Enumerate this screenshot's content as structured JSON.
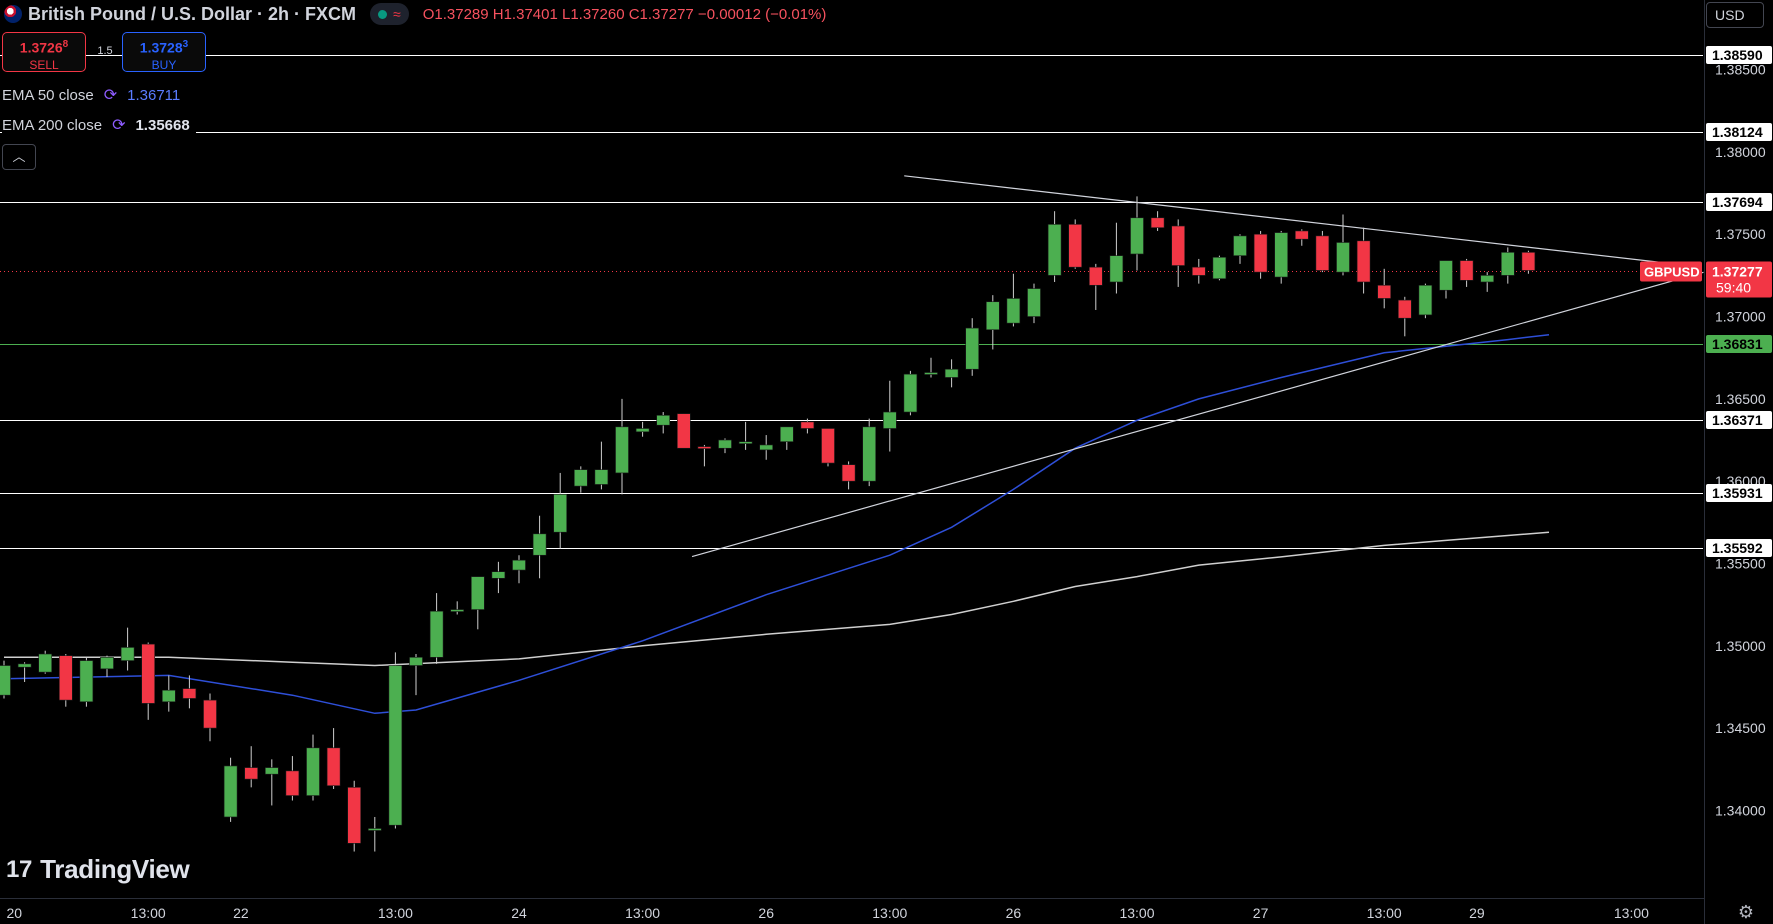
{
  "header": {
    "title": "British Pound / U.S. Dollar · 2h · FXCM",
    "ohlc": "O1.37289 H1.37401 L1.37260 C1.37277 −0.00012 (−0.01%)"
  },
  "trade": {
    "sell_price": "1.3726",
    "sell_price_sup": "8",
    "sell_label": "SELL",
    "buy_price": "1.3728",
    "buy_price_sup": "3",
    "buy_label": "BUY",
    "spread": "1.5"
  },
  "indicators": {
    "ema50_label": "EMA 50 close",
    "ema50_value": "1.36711",
    "ema200_label": "EMA 200 close",
    "ema200_value": "1.35668"
  },
  "currency": "USD",
  "logo_text": "TradingView",
  "collapse_icon": "chevron-up-icon",
  "settings_icon": "gear-icon",
  "colors": {
    "up": "#4caf50",
    "down": "#f23645",
    "ema50": "#2e4fd8",
    "ema200": "#cfcfcf",
    "price_tag": "#f23645",
    "support_tag": "#4caf50"
  },
  "chart_data": {
    "type": "candlestick",
    "symbol": "GBPUSD",
    "interval": "2h",
    "ylim": [
      1.3365,
      1.3868
    ],
    "y_ticks": [
      "1.38500",
      "1.38000",
      "1.37500",
      "1.37000",
      "1.36500",
      "1.36000",
      "1.35500",
      "1.35000",
      "1.34500",
      "1.34000"
    ],
    "x_ticks": [
      {
        "label": "20",
        "index": 0.5
      },
      {
        "label": "13:00",
        "index": 7
      },
      {
        "label": "22",
        "index": 11.5
      },
      {
        "label": "13:00",
        "index": 19
      },
      {
        "label": "24",
        "index": 25
      },
      {
        "label": "13:00",
        "index": 31
      },
      {
        "label": "26",
        "index": 37
      },
      {
        "label": "13:00",
        "index": 43
      },
      {
        "label": "26",
        "index": 49
      },
      {
        "label": "13:00",
        "index": 55
      },
      {
        "label": "27",
        "index": 61
      },
      {
        "label": "13:00",
        "index": 67
      },
      {
        "label": "29",
        "index": 71.5
      },
      {
        "label": "13:00",
        "index": 79
      }
    ],
    "x_slot_count": 82,
    "candles": [
      [
        1.347,
        1.3491,
        1.3468,
        1.3488
      ],
      [
        1.3487,
        1.349,
        1.3478,
        1.3489
      ],
      [
        1.3484,
        1.3497,
        1.3483,
        1.3495
      ],
      [
        1.3494,
        1.3495,
        1.3463,
        1.3467
      ],
      [
        1.3466,
        1.3493,
        1.3463,
        1.3491
      ],
      [
        1.3486,
        1.3494,
        1.3481,
        1.3493
      ],
      [
        1.3491,
        1.3511,
        1.3485,
        1.3499
      ],
      [
        1.3501,
        1.3502,
        1.3455,
        1.3465
      ],
      [
        1.3466,
        1.3482,
        1.346,
        1.3473
      ],
      [
        1.3474,
        1.3482,
        1.3462,
        1.3468
      ],
      [
        1.3467,
        1.3471,
        1.3442,
        1.345
      ],
      [
        1.3396,
        1.3432,
        1.3393,
        1.3427
      ],
      [
        1.3426,
        1.3439,
        1.3414,
        1.3419
      ],
      [
        1.3422,
        1.3431,
        1.3403,
        1.3426
      ],
      [
        1.3424,
        1.3433,
        1.3406,
        1.3409
      ],
      [
        1.3409,
        1.3446,
        1.3406,
        1.3438
      ],
      [
        1.3438,
        1.345,
        1.3413,
        1.3415
      ],
      [
        1.3414,
        1.3418,
        1.3375,
        1.338
      ],
      [
        1.3388,
        1.3396,
        1.3375,
        1.3389
      ],
      [
        1.3391,
        1.3496,
        1.3389,
        1.3488
      ],
      [
        1.3488,
        1.3495,
        1.347,
        1.3493
      ],
      [
        1.3493,
        1.3532,
        1.3489,
        1.3521
      ],
      [
        1.3521,
        1.3527,
        1.3519,
        1.3522
      ],
      [
        1.3522,
        1.3537,
        1.351,
        1.3542
      ],
      [
        1.3541,
        1.3551,
        1.3532,
        1.3545
      ],
      [
        1.3546,
        1.3555,
        1.3538,
        1.3552
      ],
      [
        1.3555,
        1.3579,
        1.3541,
        1.3568
      ],
      [
        1.3569,
        1.3605,
        1.3559,
        1.3592
      ],
      [
        1.3597,
        1.3609,
        1.3593,
        1.3607
      ],
      [
        1.3598,
        1.3624,
        1.3595,
        1.3607
      ],
      [
        1.3605,
        1.365,
        1.3592,
        1.3633
      ],
      [
        1.363,
        1.3636,
        1.3627,
        1.3632
      ],
      [
        1.3634,
        1.3642,
        1.3629,
        1.364
      ],
      [
        1.3641,
        1.3641,
        1.362,
        1.362
      ],
      [
        1.3621,
        1.3622,
        1.3609,
        1.362
      ],
      [
        1.362,
        1.3626,
        1.3617,
        1.3625
      ],
      [
        1.3623,
        1.3636,
        1.3619,
        1.3624
      ],
      [
        1.3619,
        1.3628,
        1.3613,
        1.3622
      ],
      [
        1.3624,
        1.3631,
        1.3619,
        1.3633
      ],
      [
        1.3636,
        1.3638,
        1.3629,
        1.3632
      ],
      [
        1.3632,
        1.3631,
        1.3609,
        1.3611
      ],
      [
        1.361,
        1.3612,
        1.3595,
        1.36
      ],
      [
        1.36,
        1.3638,
        1.3597,
        1.3633
      ],
      [
        1.3632,
        1.3661,
        1.3618,
        1.3642
      ],
      [
        1.3642,
        1.3667,
        1.364,
        1.3665
      ],
      [
        1.3666,
        1.3675,
        1.3663,
        1.3666
      ],
      [
        1.3663,
        1.3674,
        1.3657,
        1.3668
      ],
      [
        1.3668,
        1.3699,
        1.3664,
        1.3693
      ],
      [
        1.3692,
        1.3713,
        1.368,
        1.3709
      ],
      [
        1.3696,
        1.3726,
        1.3694,
        1.3711
      ],
      [
        1.37,
        1.372,
        1.3696,
        1.3717
      ],
      [
        1.3725,
        1.3764,
        1.3721,
        1.3756
      ],
      [
        1.3756,
        1.3759,
        1.3729,
        1.373
      ],
      [
        1.373,
        1.3732,
        1.3704,
        1.3719
      ],
      [
        1.3721,
        1.3757,
        1.3714,
        1.3737
      ],
      [
        1.3738,
        1.3773,
        1.3728,
        1.376
      ],
      [
        1.376,
        1.3764,
        1.3752,
        1.3754
      ],
      [
        1.3755,
        1.3759,
        1.3718,
        1.3731
      ],
      [
        1.373,
        1.3735,
        1.372,
        1.3725
      ],
      [
        1.3723,
        1.3737,
        1.3722,
        1.3736
      ],
      [
        1.3737,
        1.375,
        1.3732,
        1.3749
      ],
      [
        1.375,
        1.3752,
        1.3723,
        1.3727
      ],
      [
        1.3724,
        1.3752,
        1.372,
        1.3751
      ],
      [
        1.3752,
        1.3753,
        1.3743,
        1.3747
      ],
      [
        1.3749,
        1.3752,
        1.3727,
        1.3728
      ],
      [
        1.3727,
        1.3762,
        1.3725,
        1.3745
      ],
      [
        1.3746,
        1.3754,
        1.3714,
        1.3721
      ],
      [
        1.3719,
        1.3729,
        1.3705,
        1.3711
      ],
      [
        1.371,
        1.3712,
        1.3688,
        1.3699
      ],
      [
        1.3701,
        1.372,
        1.3699,
        1.3719
      ],
      [
        1.3716,
        1.3733,
        1.3711,
        1.3734
      ],
      [
        1.3734,
        1.3735,
        1.3718,
        1.3722
      ],
      [
        1.3721,
        1.3727,
        1.3715,
        1.3725
      ],
      [
        1.3725,
        1.3742,
        1.372,
        1.3739
      ],
      [
        1.3739,
        1.374,
        1.3726,
        1.3728
      ]
    ],
    "ema50": [
      [
        0,
        1.348
      ],
      [
        8,
        1.3482
      ],
      [
        14,
        1.347
      ],
      [
        18,
        1.3459
      ],
      [
        20,
        1.3461
      ],
      [
        25,
        1.3479
      ],
      [
        31,
        1.3503
      ],
      [
        37,
        1.3531
      ],
      [
        43,
        1.3555
      ],
      [
        46,
        1.3572
      ],
      [
        49,
        1.3595
      ],
      [
        52,
        1.362
      ],
      [
        55,
        1.3637
      ],
      [
        58,
        1.365
      ],
      [
        62,
        1.3663
      ],
      [
        67,
        1.3678
      ],
      [
        70,
        1.3682
      ],
      [
        73,
        1.3686
      ],
      [
        75,
        1.3689
      ]
    ],
    "ema200": [
      [
        0,
        1.3493
      ],
      [
        8,
        1.3493
      ],
      [
        14,
        1.349
      ],
      [
        18,
        1.3488
      ],
      [
        25,
        1.3492
      ],
      [
        31,
        1.35
      ],
      [
        37,
        1.3507
      ],
      [
        43,
        1.3513
      ],
      [
        46,
        1.3519
      ],
      [
        49,
        1.3527
      ],
      [
        52,
        1.3536
      ],
      [
        55,
        1.3542
      ],
      [
        58,
        1.3549
      ],
      [
        62,
        1.3554
      ],
      [
        67,
        1.3561
      ],
      [
        70,
        1.3564
      ],
      [
        73,
        1.3567
      ],
      [
        75,
        1.3569
      ]
    ],
    "trendlines": [
      {
        "x1": 43.7,
        "y1": 1.37855,
        "x2": 81.2,
        "y2": 1.37318,
        "color": "#d1d4dc"
      },
      {
        "x1": 33.4,
        "y1": 1.35542,
        "x2": 82.5,
        "y2": 1.37269,
        "color": "#d1d4dc"
      }
    ],
    "horizontal_levels": [
      {
        "value": 1.3859,
        "label": "1.38590",
        "color": "#ffffff"
      },
      {
        "value": 1.38124,
        "label": "1.38124",
        "color": "#ffffff"
      },
      {
        "value": 1.37694,
        "label": "1.37694",
        "color": "#ffffff"
      },
      {
        "value": 1.36831,
        "label": "1.36831",
        "color": "#4caf50",
        "tag": "green"
      },
      {
        "value": 1.36371,
        "label": "1.36371",
        "color": "#ffffff"
      },
      {
        "value": 1.35931,
        "label": "1.35931",
        "color": "#ffffff"
      },
      {
        "value": 1.35592,
        "label": "1.35592",
        "color": "#ffffff"
      }
    ],
    "last_price": {
      "value": 1.37277,
      "label": "1.37277",
      "symbol": "GBPUSD",
      "countdown": "59:40"
    }
  }
}
